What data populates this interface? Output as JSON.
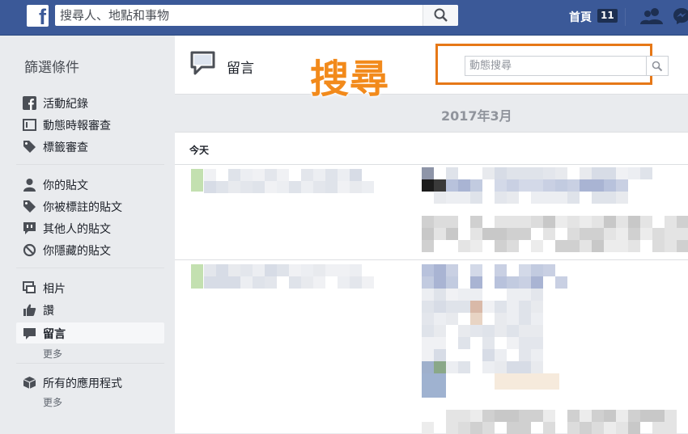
{
  "topbar": {
    "logo_glyph": "f",
    "search_placeholder": "搜尋人、地點和事物",
    "home_label": "首頁",
    "home_badge": "11",
    "icons": [
      "search-icon",
      "friends-icon",
      "messenger-icon"
    ]
  },
  "sidebar": {
    "title": "篩選條件",
    "items": [
      {
        "label": "活動紀錄",
        "icon": "facebook-icon"
      },
      {
        "label": "動態時報審查",
        "icon": "timeline-review-icon"
      },
      {
        "label": "標籤審查",
        "icon": "tag-icon"
      },
      {
        "label": "你的貼文",
        "icon": "person-icon"
      },
      {
        "label": "你被標註的貼文",
        "icon": "tag-icon"
      },
      {
        "label": "其他人的貼文",
        "icon": "speech-icon"
      },
      {
        "label": "你隱藏的貼文",
        "icon": "hidden-icon"
      },
      {
        "label": "相片",
        "icon": "photos-icon"
      },
      {
        "label": "讚",
        "icon": "like-icon"
      },
      {
        "label": "留言",
        "icon": "comment-icon"
      },
      {
        "label": "所有的應用程式",
        "icon": "apps-icon"
      }
    ],
    "more_label": "更多"
  },
  "main": {
    "title": "留言",
    "search_placeholder": "動態搜尋",
    "annotation": "搜尋",
    "month": "2017年3月",
    "feed_header": "今天"
  },
  "colors": {
    "fb_blue": "#3b5998",
    "highlight": "#e67817",
    "annotation": "#f28a1b"
  }
}
